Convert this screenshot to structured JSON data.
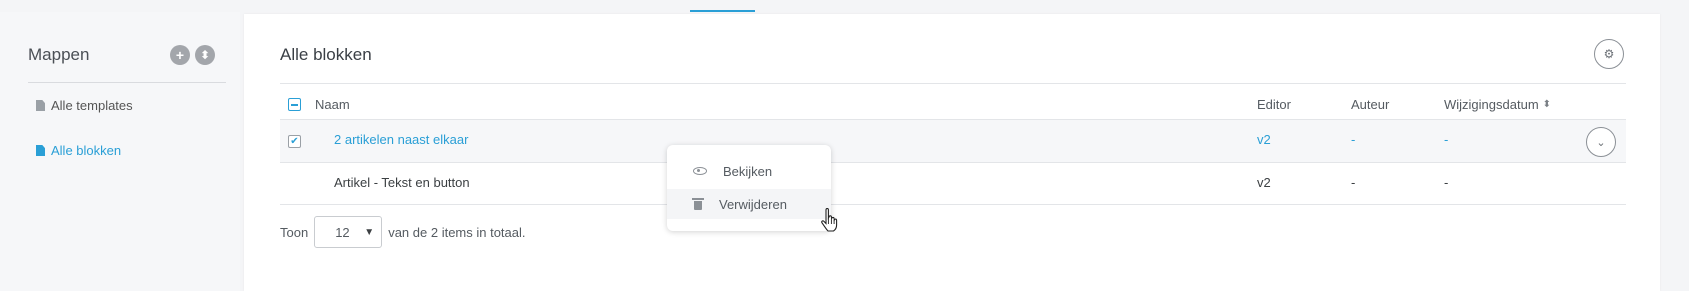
{
  "sidebar": {
    "title": "Mappen",
    "add_icon": "+",
    "sort_icon": "⬍",
    "items": [
      {
        "label": "Alle templates",
        "icon": "document-icon",
        "active": false
      },
      {
        "label": "Alle blokken",
        "icon": "document-icon",
        "active": true
      }
    ]
  },
  "main": {
    "title": "Alle blokken",
    "settings_icon": "gears-icon",
    "columns": {
      "name": "Naam",
      "editor": "Editor",
      "author": "Auteur",
      "modified": "Wijzigingsdatum"
    },
    "sort_icon": "⬍",
    "rows": [
      {
        "name": "2 artikelen naast elkaar",
        "editor": "v2",
        "author": "-",
        "modified": "-",
        "checked": true
      },
      {
        "name": "Artikel - Tekst en button",
        "editor": "v2",
        "author": "-",
        "modified": "-",
        "checked": false
      }
    ],
    "row_action_icon": "⌄",
    "footer": {
      "show_label": "Toon",
      "page_size": "12",
      "total_text": "van de 2 items in totaal."
    }
  },
  "context_menu": {
    "items": [
      {
        "label": "Bekijken",
        "icon": "eye-icon"
      },
      {
        "label": "Verwijderen",
        "icon": "trash-icon"
      }
    ]
  },
  "colors": {
    "accent": "#2a9fd6",
    "background": "#f4f5f7"
  }
}
